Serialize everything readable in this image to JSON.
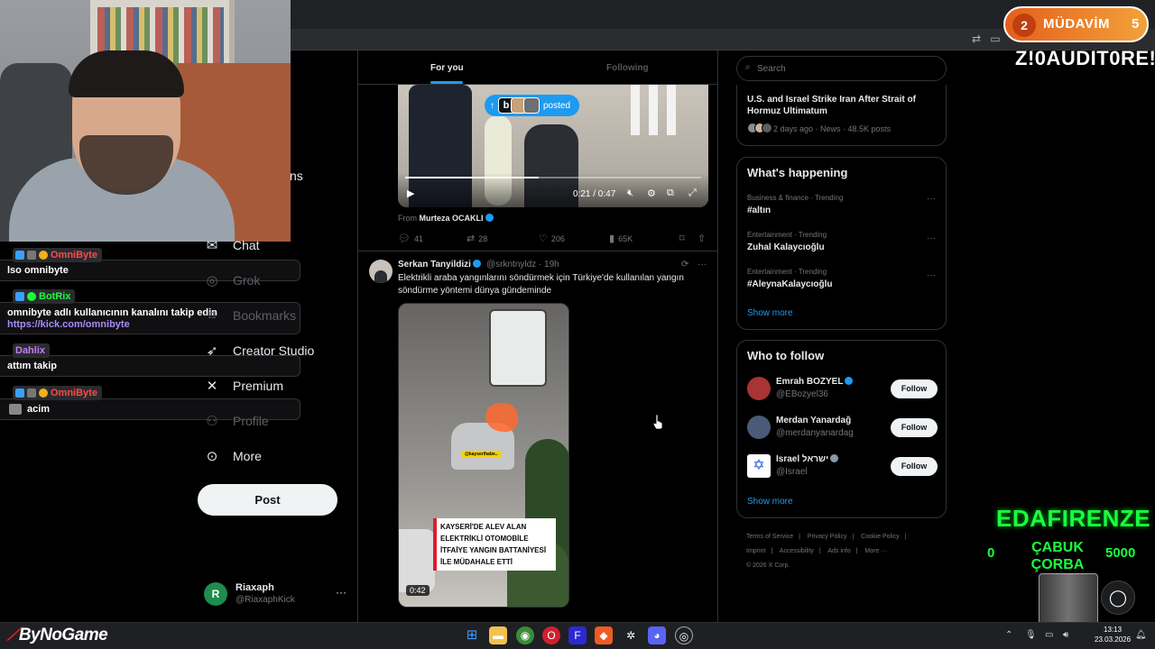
{
  "colors": {
    "accent": "#1d9bf0",
    "background": "#000000",
    "text": "#e7e9ea",
    "muted": "#71767b",
    "goal_green": "#1aff3c",
    "badge_orange": "#e45f1c"
  },
  "stream_chat": [
    {
      "user": "OmniByte",
      "user_color": "#ff4a4a",
      "message": "lso omnibyte"
    },
    {
      "user": "BotRix",
      "user_color": "#1aff3c",
      "message": "omnibyte adlı kullanıcının kanalını takip edin",
      "link": "https://kick.com/omnibyte"
    },
    {
      "user": "Dahlix",
      "user_color": "#c07cff",
      "message": "attım takip"
    },
    {
      "user": "OmniByte",
      "user_color": "#ff4a4a",
      "message": "acim"
    }
  ],
  "nav": {
    "partial_item": "ns",
    "items": [
      {
        "label": "Chat",
        "icon": "envelope-icon",
        "dim": false
      },
      {
        "label": "Grok",
        "icon": "grok-icon",
        "dim": true
      },
      {
        "label": "Bookmarks",
        "icon": "bookmark-icon",
        "dim": true
      },
      {
        "label": "Creator Studio",
        "icon": "rocket-icon",
        "dim": false
      },
      {
        "label": "Premium",
        "icon": "x-logo-icon",
        "dim": false
      },
      {
        "label": "Profile",
        "icon": "person-icon",
        "dim": true
      },
      {
        "label": "More",
        "icon": "more-circle-icon",
        "dim": false
      }
    ],
    "post_label": "Post"
  },
  "account": {
    "initial": "R",
    "name": "Riaxaph",
    "handle": "@RiaxaphKick",
    "more": "···"
  },
  "tabs": {
    "for_you": "For you",
    "following": "Following"
  },
  "posted_pill": {
    "label": "posted",
    "arrow": "↑",
    "logo": "b"
  },
  "tweet1": {
    "video_time": "0:21 / 0:47",
    "video_progress": 0.45,
    "from_prefix": "From",
    "from_name": "Murteza OCAKLI",
    "replies": "41",
    "reposts": "28",
    "likes": "206",
    "views": "65K"
  },
  "tweet2": {
    "name": "Serkan Tanyildizi",
    "handle": "@srkntnyldz · 19h",
    "text": "Elektrikli araba yangınlarını söndürmek için Türkiye'de kullanılan yangın söndürme yöntemi dünya gündeminde",
    "video_tag": "@kayserihabe..",
    "caption_lines": [
      "KAYSERİ'DE ALEV ALAN",
      "ELEKTRİKLİ OTOMOBİLE",
      "İTFAİYE YANGIN BATTANİYESİ",
      "İLE MÜDAHALE ETTİ"
    ],
    "video_time": "0:42"
  },
  "search": {
    "placeholder": "Search"
  },
  "news": {
    "title": "U.S. and Israel Strike Iran After Strait of Hormuz Ultimatum",
    "meta": "2 days ago · News · 48.5K posts"
  },
  "happening": {
    "title": "What's happening",
    "trends": [
      {
        "category": "Business & finance · Trending",
        "name": "#altın"
      },
      {
        "category": "Entertainment · Trending",
        "name": "Zuhal Kalaycıoğlu"
      },
      {
        "category": "Entertainment · Trending",
        "name": "#AleynaKalaycıoğlu"
      }
    ],
    "show_more": "Show more"
  },
  "who_to_follow": {
    "title": "Who to follow",
    "users": [
      {
        "name": "Emrah BOZYEL",
        "handle": "@EBozyel36",
        "follow": "Follow"
      },
      {
        "name": "Merdan Yanardağ",
        "handle": "@merdanyanardag",
        "follow": "Follow"
      },
      {
        "name": "Israel ישראל",
        "handle": "@Israel",
        "follow": "Follow"
      }
    ],
    "show_more": "Show more"
  },
  "footer": {
    "links": [
      "Terms of Service",
      "|",
      "Privacy Policy",
      "|",
      "Cookie Policy",
      "|",
      "Imprint",
      "|",
      "Accessibility",
      "|",
      "Ads info",
      "|",
      "More ···"
    ],
    "copyright": "© 2026 X Corp."
  },
  "overlay": {
    "mudavim_left": "2",
    "mudavim_label": "MÜDAVİM",
    "mudavim_right": "5",
    "banner_name": "Z!0AUDIT0RE!",
    "goal_title": "EDAFIRENZE",
    "goal_min": "0",
    "goal_label": "ÇABUK ÇORBA",
    "goal_max": "5000",
    "brand": "ByNoGame"
  },
  "taskbar": {
    "time": "13:13",
    "date": "23.03.2026"
  }
}
